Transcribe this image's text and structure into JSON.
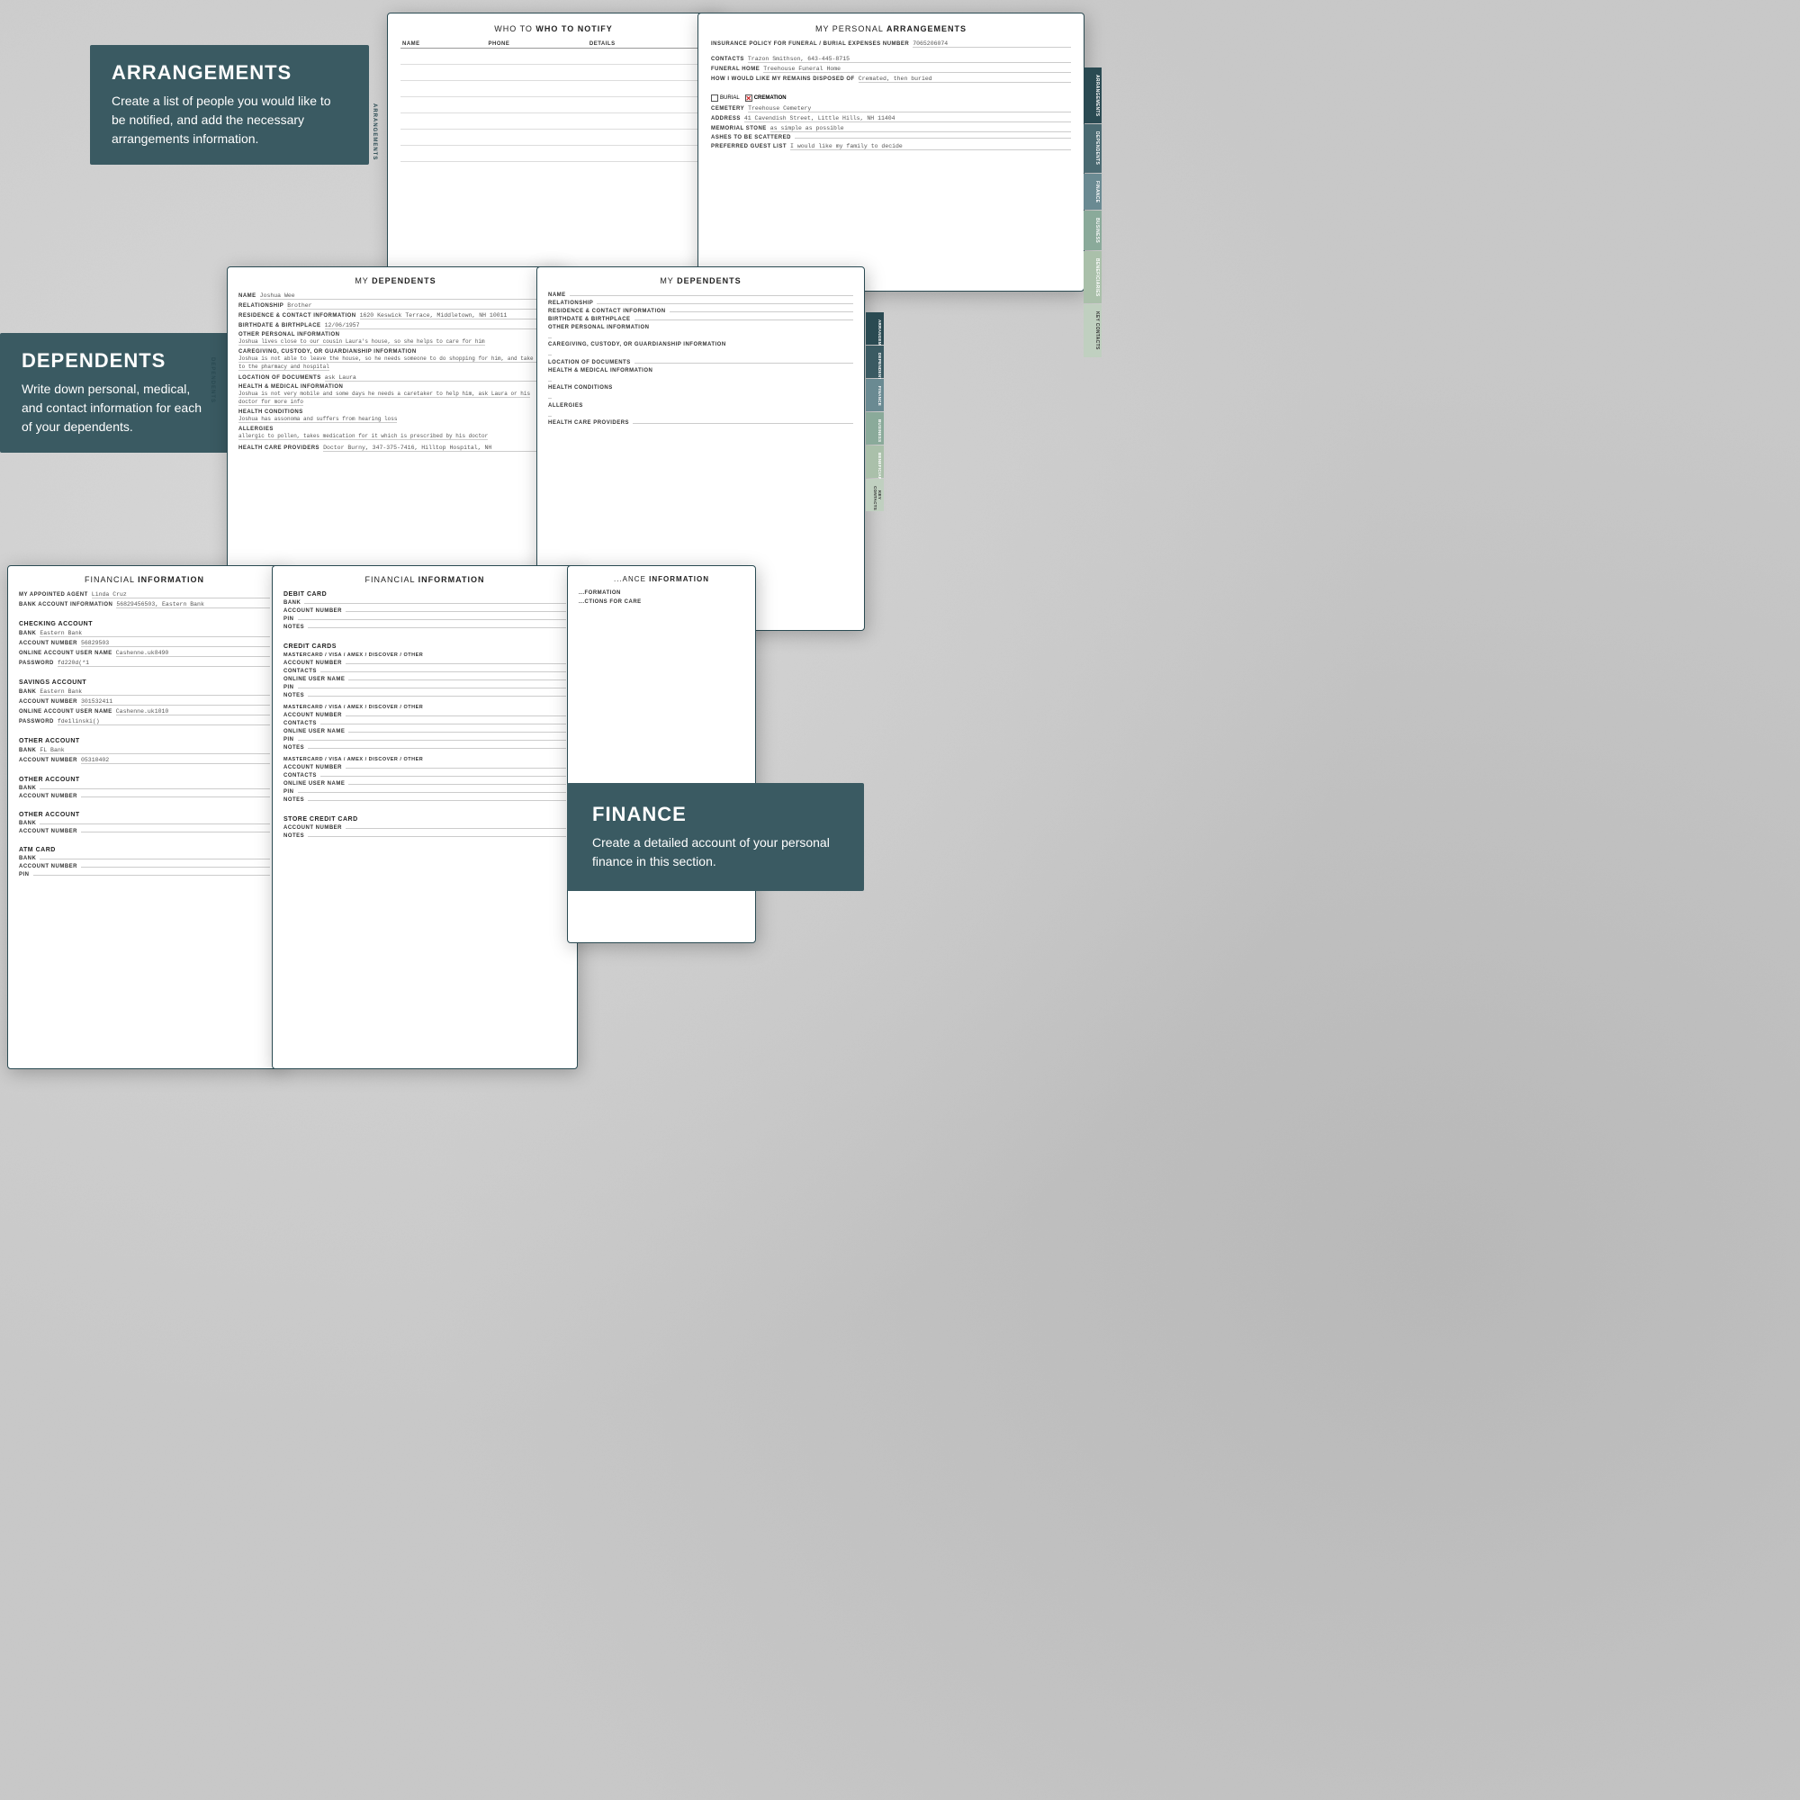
{
  "arrangements": {
    "title": "ARRANGEMENTS",
    "description": "Create a list of people you would like to be notified, and add the necessary arrangements information.",
    "notify_section": {
      "title": "WHO TO NOTIFY",
      "columns": [
        "NAME",
        "PHONE",
        "DETAILS"
      ]
    },
    "personal_section": {
      "title": "MY PERSONAL ARRANGEMENTS",
      "insurance_label": "INSURANCE POLICY FOR FUNERAL / BURIAL EXPENSES NUMBER",
      "insurance_value": "7065206074",
      "contacts_label": "CONTACTS",
      "contacts_value": "Trazon Smithson, 643-445-8715",
      "funeral_home_label": "FUNERAL HOME",
      "funeral_home_value": "Treehouse Funeral Home",
      "remains_label": "HOW I WOULD LIKE MY REMAINS DISPOSED OF",
      "remains_value": "Cremated, then buried",
      "burial_label": "BURIAL",
      "cremation_label": "CREMATION",
      "cremation_selected": true,
      "cemetery_label": "CEMETERY",
      "cemetery_value": "Treehouse Cemetery",
      "address_label": "ADDRESS",
      "address_value": "41 Cavendish Street, Little Hills, NH 11404",
      "memorial_label": "MEMORIAL STONE",
      "memorial_value": "as simple as possible",
      "ashes_label": "ASHES TO BE SCATTERED",
      "ashes_value": "",
      "guest_list_label": "PREFERRED GUEST LIST",
      "guest_list_value": "I would like my family to decide"
    }
  },
  "dependents": {
    "title": "DEPENDENTS",
    "description": "Write down personal, medical, and contact information for each of your dependents.",
    "section_title": "MY DEPENDENTS",
    "left": {
      "name_label": "NAME",
      "name_value": "Joshua Wee",
      "relationship_label": "RELATIONSHIP",
      "relationship_value": "Brother",
      "residence_label": "RESIDENCE & CONTACT INFORMATION",
      "residence_value": "1620 Keswick Terrace, Middletown, NH 10011",
      "birthdate_label": "BIRTHDATE & BIRTHPLACE",
      "birthdate_value": "12/06/1957",
      "other_info_label": "OTHER PERSONAL INFORMATION",
      "other_info_value": "Joshua lives close to our cousin Laura's house, so she helps to care for him",
      "caregiving_label": "CAREGIVING, CUSTODY, OR GUARDIANSHIP INFORMATION",
      "caregiving_value": "Joshua is not able to leave the house, so he needs someone to do shopping for him, and take him to the pharmacy and hospital",
      "location_docs_label": "LOCATION OF DOCUMENTS",
      "location_docs_value": "ask Laura",
      "health_label": "HEALTH & MEDICAL INFORMATION",
      "health_value": "Joshua is not very mobile and some days he needs a caretaker to help him, ask Laura or his doctor for more info",
      "conditions_label": "HEALTH CONDITIONS",
      "conditions_value": "Joshua has assonoma and suffers from hearing loss",
      "allergies_label": "ALLERGIES",
      "allergies_value": "allergic to pollen, takes medication for it which is prescribed by his doctor",
      "providers_label": "HEALTH CARE PROVIDERS",
      "providers_value": "Doctor Burny, 347-375-7416, Hilltop Hospital, NH"
    },
    "right": {
      "name_label": "NAME",
      "name_value": "",
      "relationship_label": "RELATIONSHIP",
      "relationship_value": "",
      "residence_label": "RESIDENCE & CONTACT INFORMATION",
      "residence_value": "",
      "birthdate_label": "BIRTHDATE & BIRTHPLACE",
      "birthdate_value": "",
      "other_info_label": "OTHER PERSONAL INFORMATION",
      "other_info_value": "",
      "caregiving_label": "CAREGIVING, CUSTODY, OR GUARDIANSHIP INFORMATION",
      "caregiving_value": "",
      "location_docs_label": "LOCATION OF DOCUMENTS",
      "location_docs_value": "",
      "health_label": "HEALTH & MEDICAL INFORMATION",
      "health_value": "",
      "conditions_label": "HEALTH CONDITIONS",
      "conditions_value": "",
      "allergies_label": "ALLERGIES",
      "allergies_value": "",
      "providers_label": "HEALTH CARE PROVIDERS",
      "providers_value": ""
    }
  },
  "finance": {
    "title": "FINANCE",
    "description": "Create a detailed account of your personal finance in this section.",
    "section_title": "FINANCIAL INFORMATION",
    "left": {
      "agent_label": "MY APPOINTED AGENT",
      "agent_value": "Linda Cruz",
      "bank_account_label": "BANK ACCOUNT INFORMATION",
      "bank_account_value": "56829456503, Eastern Bank",
      "checking_title": "CHECKING ACCOUNT",
      "checking_bank_label": "BANK",
      "checking_bank_value": "Eastern Bank",
      "checking_account_label": "ACCOUNT NUMBER",
      "checking_account_value": "56829503",
      "checking_user_label": "ONLINE ACCOUNT USER NAME",
      "checking_user_value": "Cashenne.uk8490",
      "checking_pass_label": "PASSWORD",
      "checking_pass_value": "fd220d(*1",
      "savings_title": "SAVINGS ACCOUNT",
      "savings_bank_label": "BANK",
      "savings_bank_value": "Eastern Bank",
      "savings_account_label": "ACCOUNT NUMBER",
      "savings_account_value": "301532411",
      "savings_user_label": "ONLINE ACCOUNT USER NAME",
      "savings_user_value": "Cashenne.uk1010",
      "savings_pass_label": "PASSWORD",
      "savings_pass_value": "fde1linski()",
      "other1_title": "OTHER ACCOUNT",
      "other1_bank_label": "BANK",
      "other1_bank_value": "FL Bank",
      "other1_account_label": "ACCOUNT NUMBER",
      "other1_account_value": "05310402",
      "other2_title": "OTHER ACCOUNT",
      "other2_bank_label": "BANK",
      "other2_bank_value": "",
      "other2_account_label": "ACCOUNT NUMBER",
      "other2_account_value": "",
      "other3_title": "OTHER ACCOUNT",
      "other3_bank_label": "BANK",
      "other3_bank_value": "",
      "other3_account_label": "ACCOUNT NUMBER",
      "other3_account_value": "",
      "atm_title": "ATM CARD",
      "atm_bank_label": "BANK",
      "atm_bank_value": "",
      "atm_account_label": "ACCOUNT NUMBER",
      "atm_account_value": "",
      "atm_pin_label": "PIN",
      "atm_pin_value": ""
    },
    "middle": {
      "debit_title": "DEBIT CARD",
      "debit_bank_label": "BANK",
      "debit_account_label": "ACCOUNT NUMBER",
      "debit_pin_label": "PIN",
      "debit_notes_label": "NOTES",
      "credit_title": "CREDIT CARDS",
      "mastercard1_label": "MASTERCARD / VISA / AMEX / DISCOVER / OTHER",
      "account_number_label": "ACCOUNT NUMBER",
      "contacts_label": "CONTACTS",
      "user_name_label": "ONLINE USER NAME",
      "pin_label": "PIN",
      "notes_label": "NOTES",
      "mastercard2_label": "MASTERCARD / VISA / AMEX / DISCOVER / OTHER",
      "mastercard3_label": "MASTERCARD / VISA / AMEX / DISCOVER / OTHER",
      "store_credit_title": "STORE CREDIT CARD",
      "store_account_label": "ACCOUNT NUMBER",
      "store_notes_label": "NOTES"
    }
  },
  "tabs": {
    "arrangements": "ARRANGEMENTS",
    "dependents": "DEPENDENTS",
    "finance": "FINANCE",
    "business": "BUSINESS",
    "beneficiaries": "BENEFICIARIES",
    "key_contacts": "KEY CONTACTS"
  }
}
